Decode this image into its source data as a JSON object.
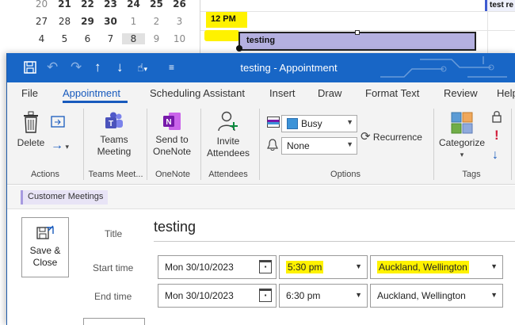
{
  "calendar": {
    "mini_rows": [
      [
        {
          "d": "20",
          "c": "muted"
        },
        {
          "d": "21",
          "c": "bold"
        },
        {
          "d": "22",
          "c": "bold"
        },
        {
          "d": "23",
          "c": "bold"
        },
        {
          "d": "24",
          "c": "bold"
        },
        {
          "d": "25",
          "c": "bold"
        },
        {
          "d": "26",
          "c": "bold"
        }
      ],
      [
        {
          "d": "27",
          "c": ""
        },
        {
          "d": "28",
          "c": ""
        },
        {
          "d": "29",
          "c": "bold"
        },
        {
          "d": "30",
          "c": "bold"
        },
        {
          "d": "1",
          "c": "muted"
        },
        {
          "d": "2",
          "c": "muted"
        },
        {
          "d": "3",
          "c": "muted"
        }
      ],
      [
        {
          "d": "4",
          "c": ""
        },
        {
          "d": "5",
          "c": ""
        },
        {
          "d": "6",
          "c": ""
        },
        {
          "d": "7",
          "c": ""
        },
        {
          "d": "8",
          "c": "sel"
        },
        {
          "d": "9",
          "c": "muted"
        },
        {
          "d": "10",
          "c": "muted"
        }
      ]
    ],
    "time_label": "12 PM",
    "event_title": "testing",
    "other_event": "test re"
  },
  "window": {
    "title": "testing  -  Appointment"
  },
  "tabs": [
    {
      "label": "File",
      "active": false
    },
    {
      "label": "Appointment",
      "active": true
    },
    {
      "label": "Scheduling Assistant",
      "active": false
    },
    {
      "label": "Insert",
      "active": false
    },
    {
      "label": "Draw",
      "active": false
    },
    {
      "label": "Format Text",
      "active": false
    },
    {
      "label": "Review",
      "active": false
    },
    {
      "label": "Help",
      "active": false
    }
  ],
  "ribbon": {
    "delete_label": "Delete",
    "teams_label_1": "Teams",
    "teams_label_2": "Meeting",
    "onenote_label_1": "Send to",
    "onenote_label_2": "OneNote",
    "invite_label_1": "Invite",
    "invite_label_2": "Attendees",
    "show_as_value": "Busy",
    "reminder_value": "None",
    "recurrence_label": "Recurrence",
    "categorize_label": "Categorize",
    "groups": {
      "actions": "Actions",
      "teams": "Teams Meet...",
      "onenote": "OneNote",
      "attendees": "Attendees",
      "options": "Options",
      "tags": "Tags"
    }
  },
  "form": {
    "category": "Customer Meetings",
    "save_label_1": "Save &",
    "save_label_2": "Close",
    "title_label": "Title",
    "title_value": "testing",
    "start_label": "Start time",
    "end_label": "End time",
    "start_date": "Mon 30/10/2023",
    "start_time": "5:30 pm",
    "start_tz": "Auckland, Wellington",
    "end_date": "Mon 30/10/2023",
    "end_time": "6:30 pm",
    "end_tz": "Auckland, Wellington"
  },
  "colors": {
    "titlebar": "#1866c6",
    "accent": "#185abd",
    "highlight": "#fff200",
    "event": "#b4b0e0"
  }
}
